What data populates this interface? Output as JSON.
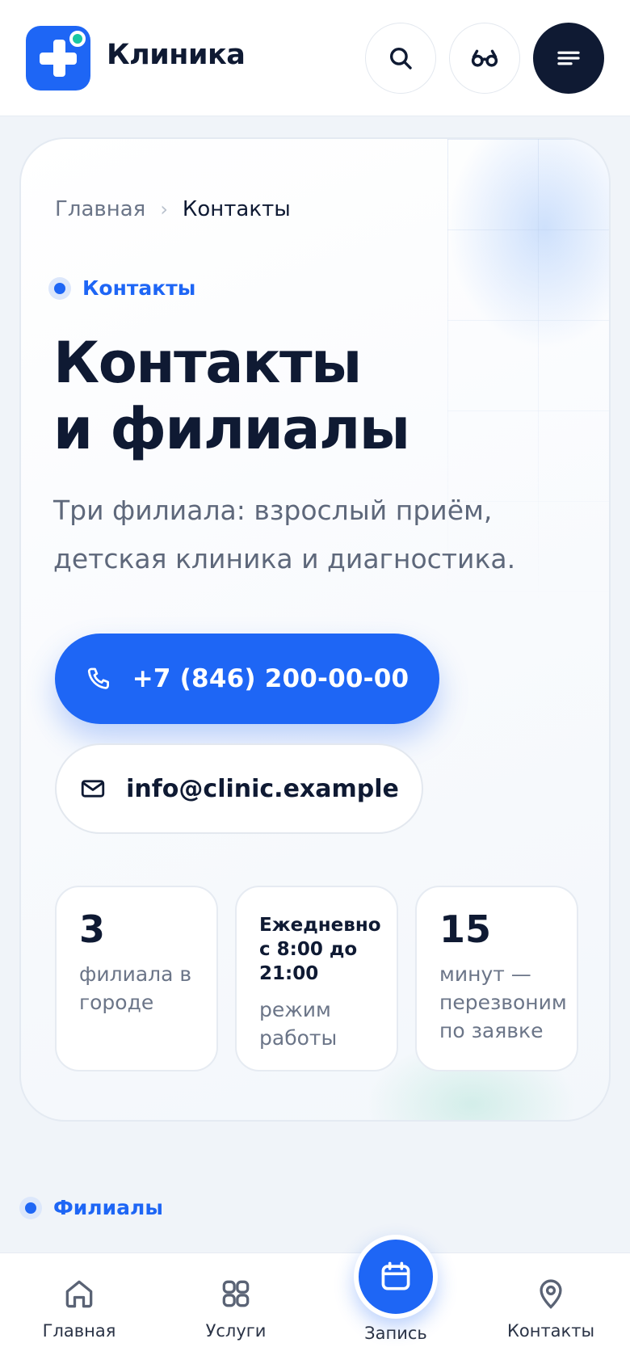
{
  "header": {
    "brand": "Клиника",
    "search_icon": "search-icon",
    "accessibility_icon": "glasses-icon",
    "menu_icon": "menu-icon"
  },
  "breadcrumb": {
    "home": "Главная",
    "separator": "›",
    "current": "Контакты"
  },
  "hero": {
    "tag": "Контакты",
    "title_line1": "Контакты",
    "title_line2": "и филиалы",
    "lead": "Три филиала: взрослый приём, детская клиника и диагностика.",
    "phone": "+7 (846) 200-00-00",
    "email": "info@clinic.example",
    "stats": [
      {
        "value": "3",
        "label": "филиала в городе"
      },
      {
        "value": "Ежедневно с 8:00 до 21:00",
        "label": "режим работы"
      },
      {
        "value": "15",
        "label": "минут — перезвоним по заявке"
      }
    ]
  },
  "section": {
    "tag": "Филиалы"
  },
  "bottom_nav": {
    "home": "Главная",
    "services": "Услуги",
    "booking": "Запись",
    "contacts": "Контакты"
  },
  "colors": {
    "accent": "#1e66f5",
    "dark": "#0f1a33",
    "teal": "#19c7a3",
    "muted": "#6b7588"
  }
}
